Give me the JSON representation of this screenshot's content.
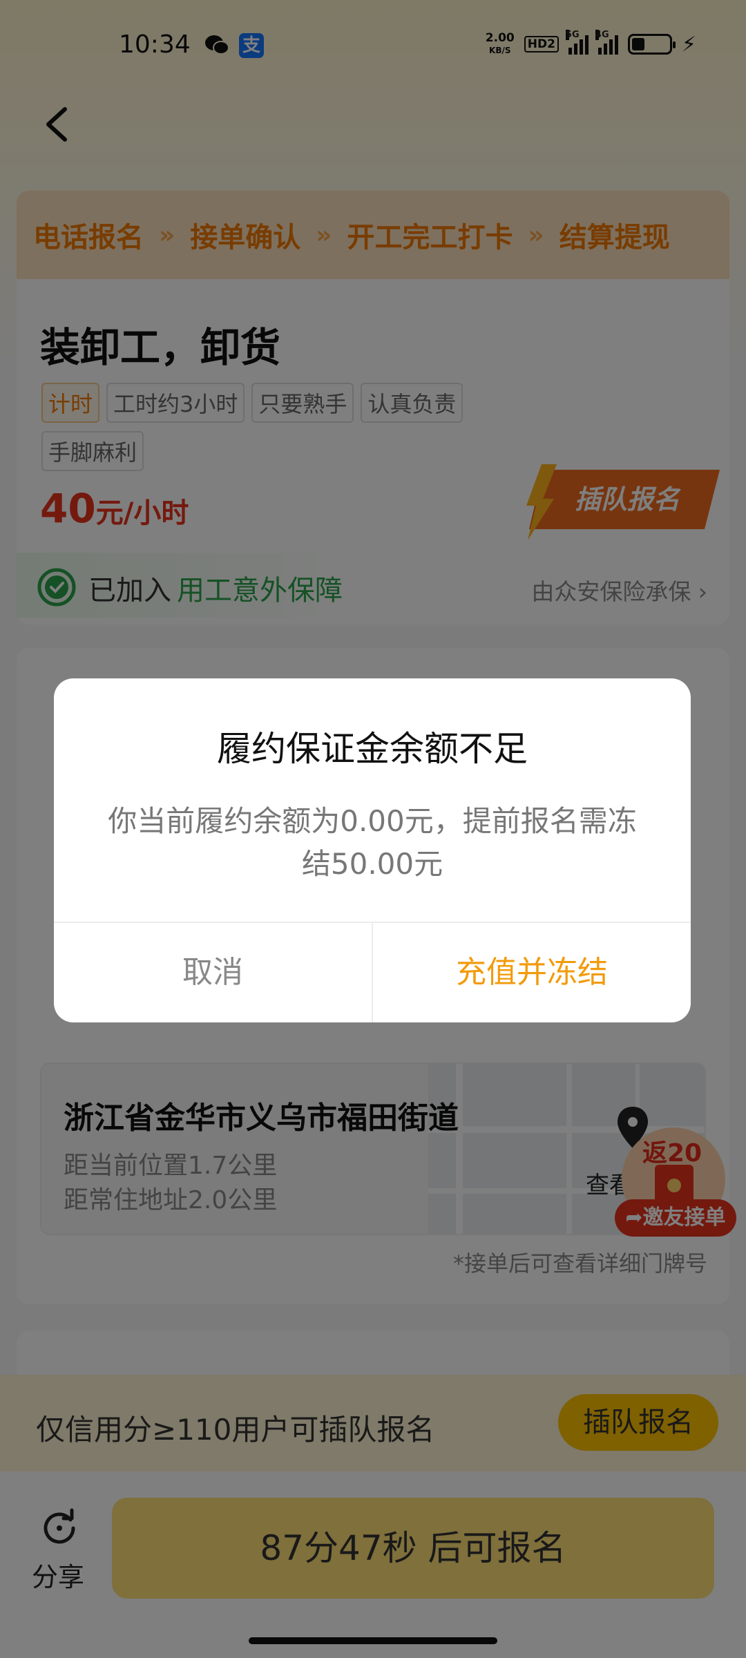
{
  "status_bar": {
    "time": "10:34",
    "wechat_icon": "wechat-icon",
    "alipay_glyph": "支",
    "net_speed_top": "2.00",
    "net_speed_unit": "KB/S",
    "hd_badge": "HD2",
    "sim1_network": "5G",
    "sim2_network": "4G",
    "battery_level": 0.35
  },
  "nav": {
    "back_icon": "chevron-left-icon"
  },
  "steps": [
    "电话报名",
    "接单确认",
    "开工完工打卡",
    "结算提现"
  ],
  "step_separator": "»",
  "job": {
    "title": "装卸工，卸货",
    "tags": [
      {
        "label": "计时",
        "highlight": true
      },
      {
        "label": "工时约3小时",
        "highlight": false
      },
      {
        "label": "只要熟手",
        "highlight": false
      },
      {
        "label": "认真负责",
        "highlight": false
      },
      {
        "label": "手脚麻利",
        "highlight": false
      }
    ],
    "price_value": "40",
    "price_unit": "元/小时",
    "jump_badge": "插队报名",
    "insurance_joined": "已加入",
    "insurance_name": "用工意外保障",
    "insurance_provider": "由众安保险承保 ›"
  },
  "location": {
    "address": "浙江省金华市义乌市福田街道",
    "distance_current": "距当前位置1.7公里",
    "distance_home": "距常住地址2.0公里",
    "view_label": "查看",
    "door_note": "*接单后可查看详细门牌号"
  },
  "red_packet": {
    "amount_label": "返20",
    "invite_label": "➦邀友接单"
  },
  "credit_banner": {
    "text": "仅信用分≥110用户可插队报名",
    "button": "插队报名"
  },
  "bottom": {
    "share_label": "分享",
    "signup_label": "87分47秒 后可报名"
  },
  "dialog": {
    "title": "履约保证金余额不足",
    "message": "你当前履约余额为0.00元，提前报名需冻结50.00元",
    "cancel": "取消",
    "confirm": "充值并冻结"
  },
  "colors": {
    "accent_orange": "#f07800",
    "price_red": "#e8321c",
    "insurance_green": "#2aa34a",
    "confirm_orange": "#f29b0c",
    "signup_yellow": "#ffe079"
  }
}
